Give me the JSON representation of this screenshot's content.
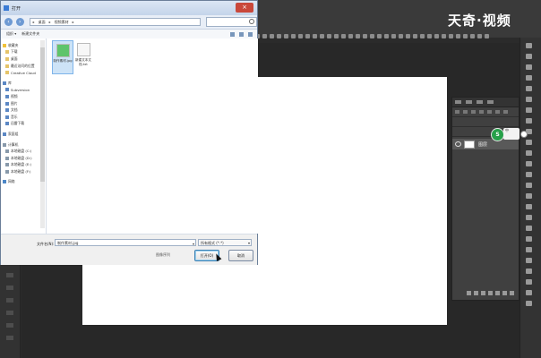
{
  "watermark": "天奇·视频",
  "photoshop": {
    "layer_name": "图层",
    "badge_label": "S",
    "tag_label": "中"
  },
  "dialog": {
    "title": "打开",
    "close_label": "×",
    "address_parts": [
      "▸",
      "桌面",
      "▸",
      "视频素材",
      "▸"
    ],
    "toolbar": {
      "organize_label": "组织 ▾",
      "new_folder_label": "新建文件夹"
    },
    "sidebar": [
      {
        "label": "收藏夹",
        "icon": "star-icon",
        "head": true
      },
      {
        "label": "下载",
        "icon": "folder-icon"
      },
      {
        "label": "桌面",
        "icon": "folder-icon"
      },
      {
        "label": "最近访问的位置",
        "icon": "folder-icon"
      },
      {
        "label": "Creative Cloud",
        "icon": "folder-icon"
      },
      {
        "label": "库",
        "icon": "library-icon",
        "head": true
      },
      {
        "label": "Subversion",
        "icon": "library-icon"
      },
      {
        "label": "视频",
        "icon": "library-icon"
      },
      {
        "label": "图片",
        "icon": "library-icon"
      },
      {
        "label": "文档",
        "icon": "library-icon"
      },
      {
        "label": "音乐",
        "icon": "library-icon"
      },
      {
        "label": "迅雷下载",
        "icon": "library-icon"
      },
      {
        "label": "家庭组",
        "icon": "library-icon",
        "head": true
      },
      {
        "label": "计算机",
        "icon": "drive-icon",
        "head": true
      },
      {
        "label": "本地磁盘 (C:)",
        "icon": "drive-icon"
      },
      {
        "label": "本地磁盘 (D:)",
        "icon": "drive-icon"
      },
      {
        "label": "本地磁盘 (E:)",
        "icon": "drive-icon"
      },
      {
        "label": "本地磁盘 (F:)",
        "icon": "drive-icon"
      },
      {
        "label": "网络",
        "icon": "network-icon",
        "head": true
      }
    ],
    "files": [
      {
        "name": "制作素材.jpg",
        "selected": true
      },
      {
        "name": "新建文本文档.txt",
        "selected": false
      }
    ],
    "filename_label": "文件名(N):",
    "filename_value": "制作素材.jpg",
    "filetype_value": "所有格式 (*.*)",
    "sequence_label": "图像序列",
    "open_label": "打开(O)",
    "cancel_label": "取消"
  }
}
